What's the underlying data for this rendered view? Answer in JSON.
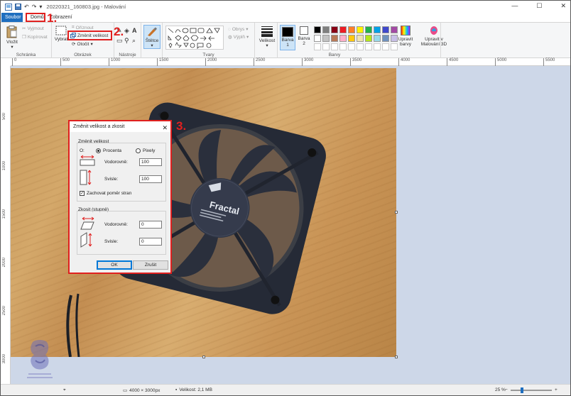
{
  "window": {
    "title": "20220321_160803.jpg - Malování",
    "minimize": "—",
    "maximize": "☐",
    "close": "✕"
  },
  "quick_access": [
    "save-icon",
    "undo-icon",
    "redo-icon",
    "customize-icon"
  ],
  "tabs": {
    "file": "Soubor",
    "home": "Domů",
    "view": "Zobrazení"
  },
  "ribbon": {
    "clipboard": {
      "label": "Schránka",
      "paste": "Vložit",
      "cut": "Vyjmout",
      "copy": "Kopírovat"
    },
    "image": {
      "label": "Obrázek",
      "select": "Vybrat",
      "crop": "Oříznout",
      "resize": "Změnit velikost",
      "rotate": "Otočit"
    },
    "tools": {
      "label": "Nástroje"
    },
    "brushes": {
      "label": "Štětce"
    },
    "shapes": {
      "label": "Tvary",
      "outline": "Obrys",
      "fill": "Výplň"
    },
    "size": {
      "label": "Velikost"
    },
    "colors": {
      "label": "Barvy",
      "color1": "Barva 1",
      "color2": "Barva 2",
      "edit": "Upravit barvy",
      "paint3d": "Upravit v Malování 3D",
      "palette": [
        "#000000",
        "#7f7f7f",
        "#880015",
        "#ed1c24",
        "#ff7f27",
        "#fff200",
        "#22b14c",
        "#00a2e8",
        "#3f48cc",
        "#a349a4",
        "#ffffff",
        "#c3c3c3",
        "#b97a57",
        "#ffaec9",
        "#ffc90e",
        "#efe4b0",
        "#b5e61d",
        "#99d9ea",
        "#7092be",
        "#c8bfe7"
      ]
    }
  },
  "annotations": {
    "step1": "1.",
    "step2": "2.",
    "step3": "3."
  },
  "ruler": {
    "h": [
      "0",
      "500",
      "1000",
      "1500",
      "2000",
      "2500",
      "3000",
      "3500",
      "4000",
      "4500",
      "5000",
      "5500"
    ],
    "v": [
      "500",
      "1000",
      "1500",
      "2000",
      "2500",
      "3000"
    ]
  },
  "dialog": {
    "title": "Změnit velikost a zkosit",
    "close": "✕",
    "resize_label": "Změnit velikost",
    "by_label": "O:",
    "percent": "Procenta",
    "pixels": "Pixely",
    "horizontal": "Vodorovně:",
    "vertical": "Svisle:",
    "h_value": "100",
    "v_value": "100",
    "keep_ratio": "Zachovat poměr stran",
    "skew_label": "Zkosit (stupně)",
    "skew_h": "Vodorovně:",
    "skew_v": "Svisle:",
    "skew_h_value": "0",
    "skew_v_value": "0",
    "ok": "OK",
    "cancel": "Zrušit"
  },
  "photo": {
    "fan_brand": "Fractal"
  },
  "status": {
    "dimensions": "4000 × 3000px",
    "size": "Velikost: 2,1 MB",
    "zoom": "25 %"
  }
}
